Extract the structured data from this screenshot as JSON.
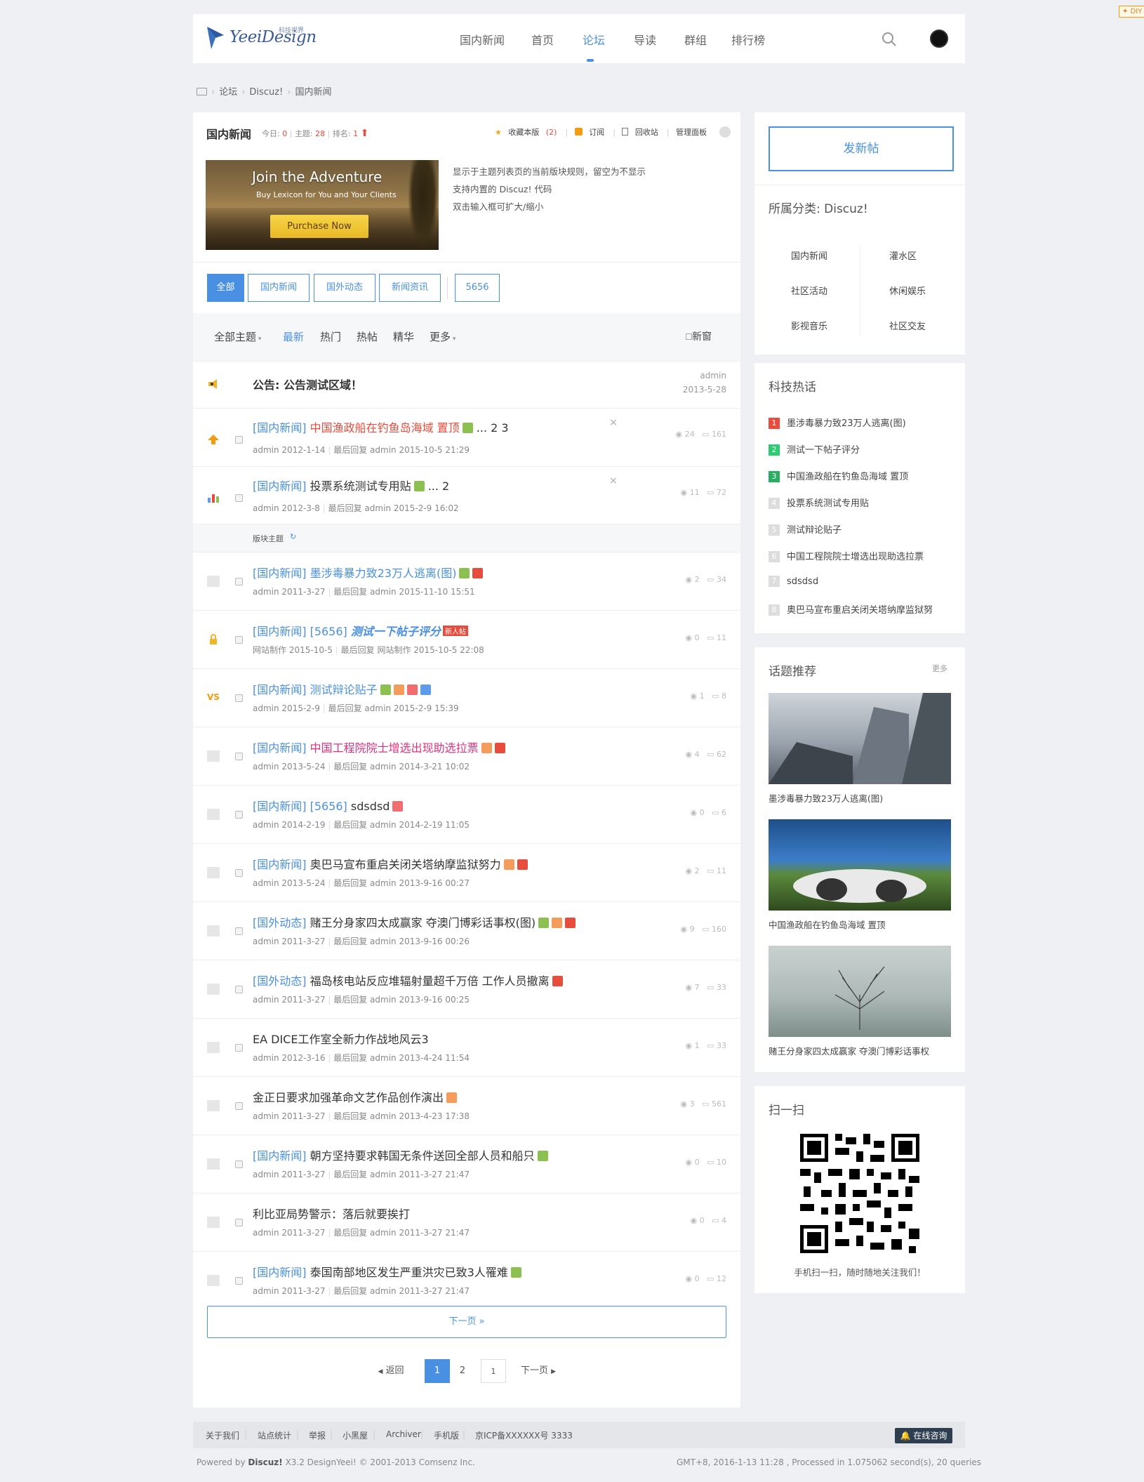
{
  "header": {
    "logo_text": "YeeiDesign",
    "logo_sub": "科技视界",
    "nav": [
      "国内新闻",
      "首页",
      "论坛",
      "导读",
      "群组",
      "排行榜"
    ],
    "nav_active": "论坛",
    "div_badge": "DIY"
  },
  "breadcrumb": [
    "论坛",
    "Discuz!",
    "国内新闻"
  ],
  "forum": {
    "title": "国内新闻",
    "today_label": "今日:",
    "today": "0",
    "topics_label": "主题:",
    "topics": "28",
    "rank_label": "排名:",
    "rank": "1",
    "favorite": "收藏本版",
    "favorite_count": "(2)",
    "subscribe": "订阅",
    "recycle": "回收站",
    "manage": "管理面板",
    "rules": [
      "显示于主题列表页的当前版块规则，留空为不显示",
      "支持内置的 Discuz! 代码",
      "双击输入框可扩大/缩小"
    ]
  },
  "ad": {
    "title": "Join the Adventure",
    "subtitle": "Buy Lexicon for You and Your Clients",
    "button": "Purchase Now"
  },
  "type_tabs": [
    "全部",
    "国内新闻",
    "国外动态",
    "新闻资讯",
    "5656"
  ],
  "filters": {
    "all_topics": "全部主题",
    "items": [
      "最新",
      "热门",
      "热帖",
      "精华",
      "更多"
    ],
    "new_window": "新窗"
  },
  "announcement": {
    "title": "公告: 公告测试区域！",
    "author": "admin",
    "date": "2013-5-28"
  },
  "sticky": [
    {
      "tag": "[国内新闻]",
      "title": "中国渔政船在钓鱼岛海域 置顶",
      "pages": "... 2  3",
      "meta_author": "admin 2012-1-14",
      "meta_last": "最后回复 admin 2015-10-5 21:29",
      "views": "24",
      "replies": "161"
    },
    {
      "tag": "[国内新闻]",
      "title": "投票系统测试专用贴",
      "pages": "... 2",
      "meta_author": "admin 2012-3-8",
      "meta_last": "最后回复 admin 2015-2-9 16:02",
      "views": "11",
      "replies": "72"
    }
  ],
  "section_label": "版块主题",
  "threads": [
    {
      "tag": "[国内新闻]",
      "title": "墨涉毒暴力致23万人逃离(图)",
      "meta_author": "admin 2011-3-27",
      "meta_last": "最后回复 admin 2015-11-10 15:51",
      "views": "2",
      "replies": "34"
    },
    {
      "tag": "[国内新闻] [5656]",
      "title": "测试一下帖子评分",
      "badge": "新人帖",
      "meta_author": "网站制作 2015-10-5",
      "meta_last": "最后回复 网站制作 2015-10-5 22:08",
      "views": "0",
      "replies": "11"
    },
    {
      "tag": "[国内新闻]",
      "title": "测试辩论贴子",
      "meta_author": "admin 2015-2-9",
      "meta_last": "最后回复 admin 2015-2-9 15:39",
      "views": "1",
      "replies": "8"
    },
    {
      "tag": "[国内新闻]",
      "title": "中国工程院院士增选出现助选拉票",
      "meta_author": "admin 2013-5-24",
      "meta_last": "最后回复 admin 2014-3-21 10:02",
      "views": "4",
      "replies": "62"
    },
    {
      "tag": "[国内新闻] [5656]",
      "title": "sdsdsd",
      "meta_author": "admin 2014-2-19",
      "meta_last": "最后回复 admin 2014-2-19 11:05",
      "views": "0",
      "replies": "6"
    },
    {
      "tag": "[国内新闻]",
      "title": "奥巴马宣布重启关闭关塔纳摩监狱努力",
      "meta_author": "admin 2013-5-24",
      "meta_last": "最后回复 admin 2013-9-16 00:27",
      "views": "2",
      "replies": "11"
    },
    {
      "tag": "[国外动态]",
      "title": "赌王分身家四太成赢家 夺澳门博彩话事权(图)",
      "meta_author": "admin 2011-3-27",
      "meta_last": "最后回复 admin 2013-9-16 00:26",
      "views": "9",
      "replies": "160"
    },
    {
      "tag": "[国外动态]",
      "title": "福岛核电站反应堆辐射量超千万倍 工作人员撤离",
      "meta_author": "admin 2011-3-27",
      "meta_last": "最后回复 admin 2013-9-16 00:25",
      "views": "7",
      "replies": "33"
    },
    {
      "tag": "",
      "title": "EA DICE工作室全新力作战地风云3",
      "meta_author": "admin 2012-3-16",
      "meta_last": "最后回复 admin 2013-4-24 11:54",
      "views": "1",
      "replies": "33"
    },
    {
      "tag": "",
      "title": "金正日要求加强革命文艺作品创作演出",
      "meta_author": "admin 2011-3-27",
      "meta_last": "最后回复 admin 2013-4-23 17:38",
      "views": "3",
      "replies": "561"
    },
    {
      "tag": "[国内新闻]",
      "title": "朝方坚持要求韩国无条件送回全部人员和船只",
      "meta_author": "admin 2011-3-27",
      "meta_last": "最后回复 admin 2011-3-27 21:47",
      "views": "0",
      "replies": "10"
    },
    {
      "tag": "",
      "title": "利比亚局势警示：落后就要挨打",
      "meta_author": "admin 2011-3-27",
      "meta_last": "最后回复 admin 2011-3-27 21:47",
      "views": "0",
      "replies": "4"
    },
    {
      "tag": "[国内新闻]",
      "title": "泰国南部地区发生严重洪灾已致3人罹难",
      "meta_author": "admin 2011-3-27",
      "meta_last": "最后回复 admin 2011-3-27 21:47",
      "views": "0",
      "replies": "12"
    }
  ],
  "next_page": "下一页 »",
  "pager": {
    "back": "返回",
    "pages": [
      "1",
      "2"
    ],
    "input": "1",
    "next": "下一页"
  },
  "sidebar": {
    "post_button": "发新帖",
    "category_heading": "所属分类: Discuz!",
    "categories": [
      "国内新闻",
      "灌水区",
      "社区活动",
      "休闲娱乐",
      "影视音乐",
      "社区交友"
    ],
    "hot_heading": "科技热话",
    "hot": [
      "墨涉毒暴力致23万人逃离(图)",
      "测试一下帖子评分",
      "中国渔政船在钓鱼岛海域 置顶",
      "投票系统测试专用贴",
      "测试辩论贴子",
      "中国工程院院士增选出现助选拉票",
      "sdsdsd",
      "奥巴马宣布重启关闭关塔纳摩监狱努"
    ],
    "hot_colors": [
      "#e74c3c",
      "#2ecc71",
      "#27ae60",
      "#dddddd",
      "#dddddd",
      "#dddddd",
      "#dddddd",
      "#dddddd"
    ],
    "topics_heading": "话题推荐",
    "topics_more": "更多",
    "topics": [
      "墨涉毒暴力致23万人逃离(图)",
      "中国渔政船在钓鱼岛海域 置顶",
      "赌王分身家四太成赢家 夺澳门博彩话事权"
    ],
    "qr_heading": "扫一扫",
    "qr_caption": "手机扫一扫，随时随地关注我们！"
  },
  "footer": {
    "links": [
      "关于我们",
      "站点统计",
      "举报",
      "小黑屋",
      "Archiver",
      "手机版",
      "京ICP备XXXXXX号 3333"
    ],
    "online": "在线咨询",
    "copy_prefix": "Powered by",
    "copy_brand": "Discuz!",
    "copy_rest": "X3.2 DesignYeei! © 2001-2013 Comsenz Inc.",
    "stats": "GMT+8, 2016-1-13 11:28 , Processed in 1.075062 second(s), 20 queries"
  },
  "colors": {
    "accent": "#4a90e2",
    "danger": "#e74c3c"
  }
}
